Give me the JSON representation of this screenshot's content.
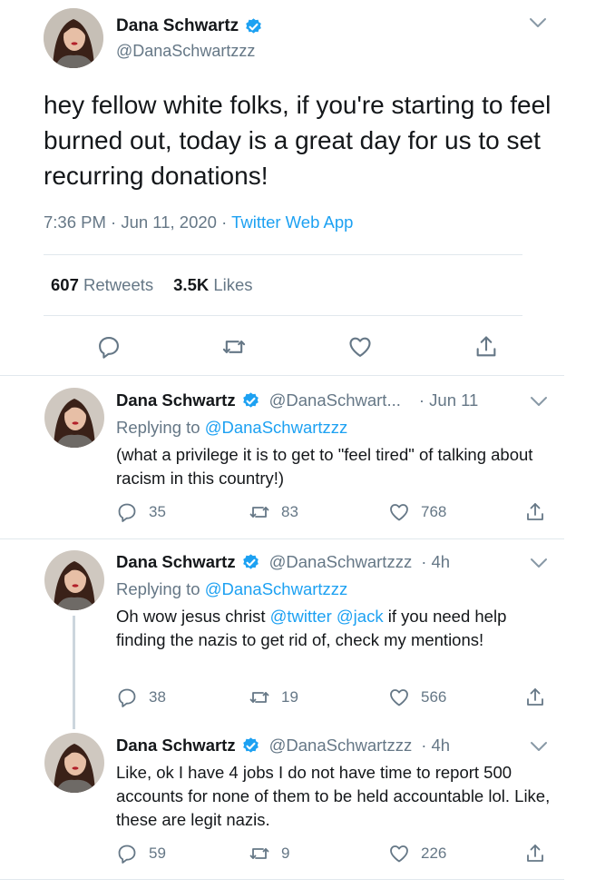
{
  "main_tweet": {
    "name": "Dana Schwartz",
    "handle": "@DanaSchwartzzz",
    "text": "hey fellow white folks, if you're starting to feel burned out, today is a great day for us to set recurring donations!",
    "time": "7:36 PM · Jun 11, 2020 · ",
    "source": "Twitter Web App",
    "retweets_count": "607",
    "retweets_label": "Retweets",
    "likes_count": "3.5K",
    "likes_label": "Likes"
  },
  "replies": [
    {
      "name": "Dana Schwartz",
      "handle": "@DanaSchwart...",
      "time": "· Jun 11",
      "replying_prefix": "Replying to ",
      "replying_to": "@DanaSchwartzzz",
      "text": "(what a privilege it is to get to \"feel tired\" of talking about racism in this country!)",
      "reply_count": "35",
      "retweet_count": "83",
      "like_count": "768"
    },
    {
      "name": "Dana Schwartz",
      "handle": "@DanaSchwartzzz",
      "time": "· 4h",
      "replying_prefix": "Replying to ",
      "replying_to": "@DanaSchwartzzz",
      "text_before": "Oh wow jesus christ ",
      "mention_1": "@twitter",
      "text_mid": " ",
      "mention_2": "@jack",
      "text_after": " if you need help finding the nazis to get rid of, check my mentions!",
      "reply_count": "38",
      "retweet_count": "19",
      "like_count": "566"
    },
    {
      "name": "Dana Schwartz",
      "handle": "@DanaSchwartzzz",
      "time": "· 4h",
      "text": "Like, ok I have 4 jobs I do not have time to report 500 accounts for none of them to be held accountable lol. Like, these are legit nazis.",
      "reply_count": "59",
      "retweet_count": "9",
      "like_count": "226"
    }
  ],
  "icons": {
    "reply": "reply-icon",
    "retweet": "retweet-icon",
    "like": "heart-icon",
    "share": "share-icon",
    "verified": "verified-badge-icon",
    "more": "chevron-down-icon"
  },
  "colors": {
    "link": "#1da1f2",
    "secondary_text": "#657786",
    "primary_text": "#14171a",
    "divider": "#e1e8ed"
  }
}
